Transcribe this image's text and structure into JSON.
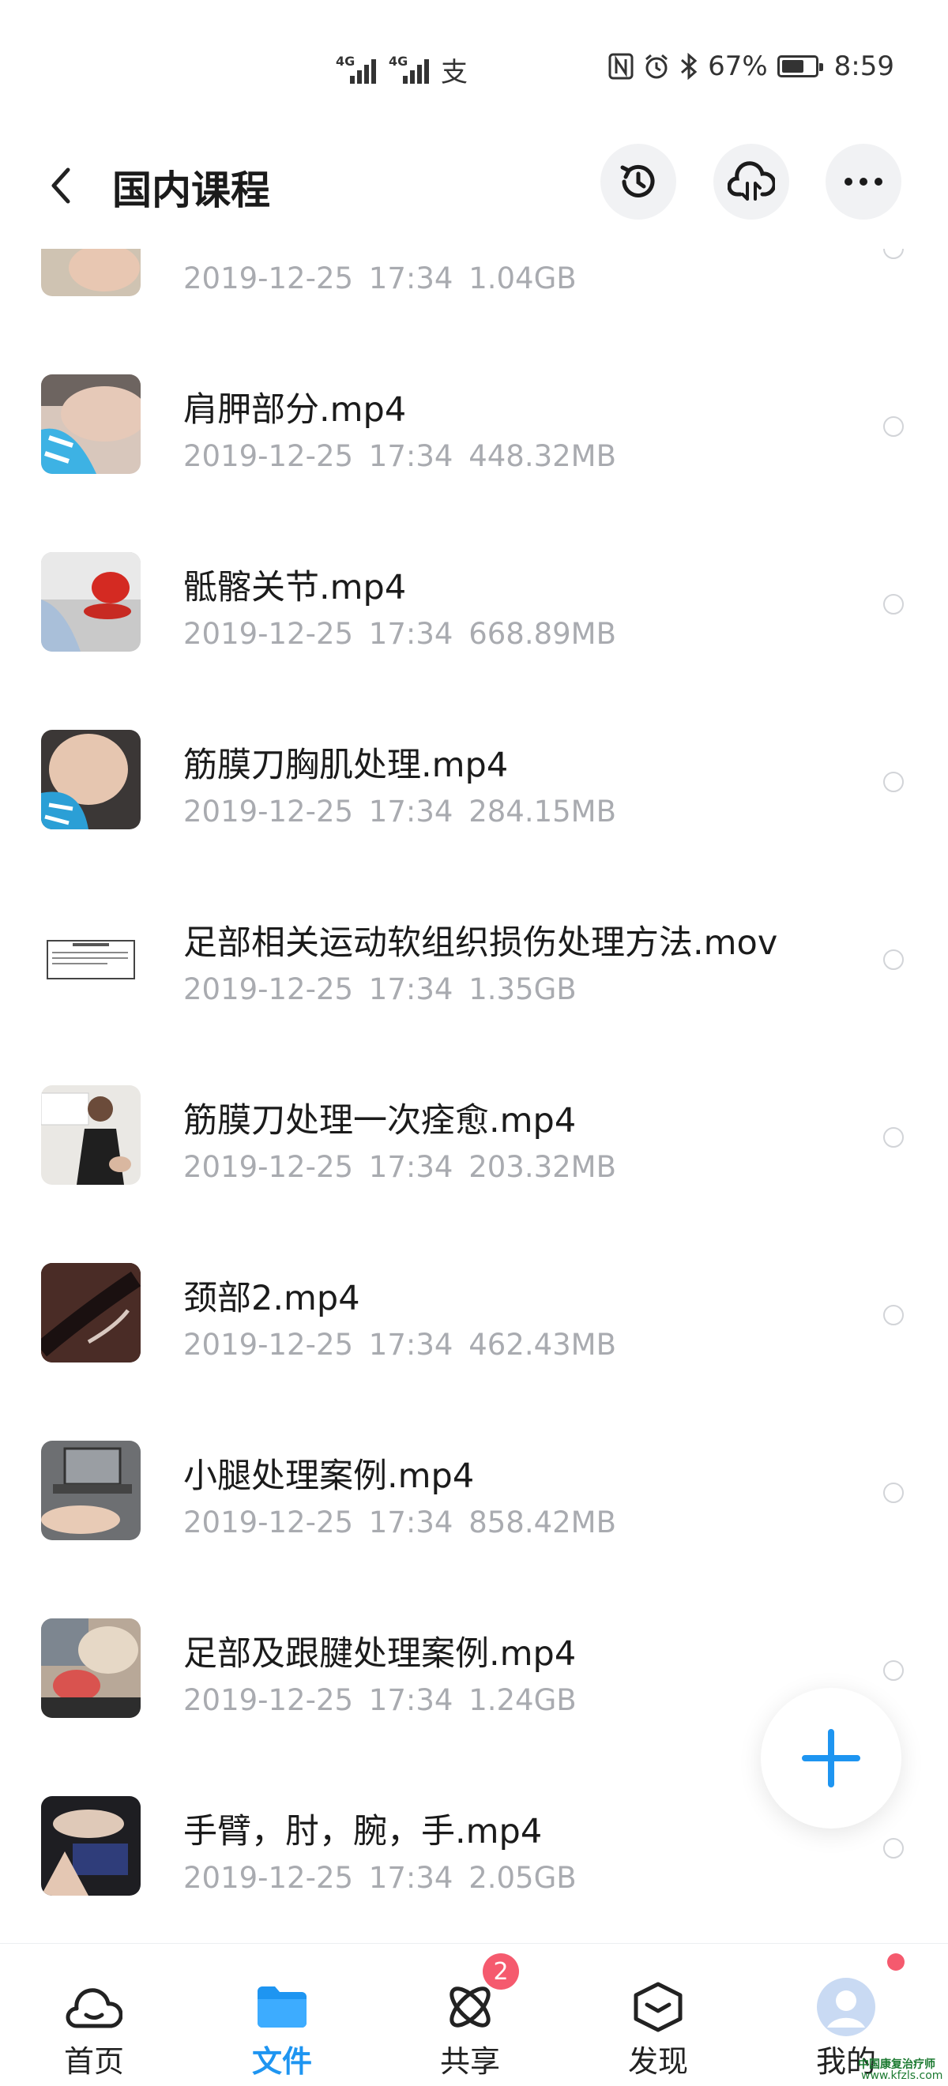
{
  "status_bar": {
    "signal1_label": "4G",
    "signal2_label": "4G",
    "alipay_glyph": "支",
    "battery_text": "67%",
    "battery_level": 0.67,
    "time": "8:59",
    "icons": [
      "nfc-icon",
      "alarm-icon",
      "bluetooth-icon"
    ]
  },
  "header": {
    "title": "国内课程",
    "buttons": [
      "history-icon",
      "cloud-transfer-icon",
      "more-icon"
    ]
  },
  "files": [
    {
      "name": "",
      "date": "2019-12-25",
      "time": "17:34",
      "size": "1.04GB",
      "thumb": "skin"
    },
    {
      "name": "肩胛部分.mp4",
      "date": "2019-12-25",
      "time": "17:34",
      "size": "448.32MB",
      "thumb": "shoulder"
    },
    {
      "name": "骶髂关节.mp4",
      "date": "2019-12-25",
      "time": "17:34",
      "size": "668.89MB",
      "thumb": "chair"
    },
    {
      "name": "筋膜刀胸肌处理.mp4",
      "date": "2019-12-25",
      "time": "17:34",
      "size": "284.15MB",
      "thumb": "chest"
    },
    {
      "name": "足部相关运动软组织损伤处理方法.mov",
      "date": "2019-12-25",
      "time": "17:34",
      "size": "1.35GB",
      "thumb": "doc"
    },
    {
      "name": "筋膜刀处理一次痊愈.mp4",
      "date": "2019-12-25",
      "time": "17:34",
      "size": "203.32MB",
      "thumb": "person"
    },
    {
      "name": "颈部2.mp4",
      "date": "2019-12-25",
      "time": "17:34",
      "size": "462.43MB",
      "thumb": "dark"
    },
    {
      "name": "小腿处理案例.mp4",
      "date": "2019-12-25",
      "time": "17:34",
      "size": "858.42MB",
      "thumb": "laptop"
    },
    {
      "name": "足部及跟腱处理案例.mp4",
      "date": "2019-12-25",
      "time": "17:34",
      "size": "1.24GB",
      "thumb": "foot"
    },
    {
      "name": "手臂，肘，腕，手.mp4",
      "date": "2019-12-25",
      "time": "17:34",
      "size": "2.05GB",
      "thumb": "arm"
    }
  ],
  "fab": {
    "icon": "plus-icon",
    "color": "#1e95f1"
  },
  "nav": {
    "items": [
      {
        "label": "首页",
        "icon": "cloud-home-icon"
      },
      {
        "label": "文件",
        "icon": "folder-icon"
      },
      {
        "label": "共享",
        "icon": "atom-share-icon",
        "badge": "2"
      },
      {
        "label": "发现",
        "icon": "discover-box-icon"
      },
      {
        "label": "我的",
        "icon": "avatar-icon"
      }
    ],
    "active_index": 1
  },
  "watermark": {
    "line1": "中国康复治疗师",
    "line2": "www.kfzls.com"
  },
  "colors": {
    "accent": "#1e95f1",
    "badge": "#f55a6e",
    "meta": "#a9abb0"
  }
}
